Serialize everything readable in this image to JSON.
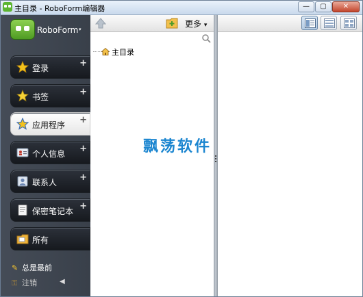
{
  "window": {
    "title": "主目录 - RoboForm编辑器",
    "minimize_glyph": "—",
    "maximize_glyph": "▢",
    "close_glyph": "✕"
  },
  "sidebar": {
    "brand": "RoboForm",
    "brand_caret": "▾",
    "items": [
      {
        "label": "登录",
        "icon": "login-star-icon",
        "plus": "+",
        "active": false
      },
      {
        "label": "书签",
        "icon": "bookmark-star-icon",
        "plus": "+",
        "active": false
      },
      {
        "label": "应用程序",
        "icon": "application-star-icon",
        "plus": "+",
        "active": true
      },
      {
        "label": "个人信息",
        "icon": "identity-card-icon",
        "plus": "+",
        "active": false
      },
      {
        "label": "联系人",
        "icon": "contacts-icon",
        "plus": "+",
        "active": false
      },
      {
        "label": "保密笔记本",
        "icon": "safenote-icon",
        "plus": "+",
        "active": false
      },
      {
        "label": "所有",
        "icon": "all-items-icon",
        "plus": "",
        "active": false
      }
    ],
    "pinned_label": "总是最前",
    "logout_label": "注销",
    "collapse_glyph": "◀"
  },
  "middle": {
    "more_label": "更多",
    "more_caret": "▾",
    "tree_root": "主目录",
    "watermark": "飘荡软件"
  },
  "right": {
    "views": [
      "detail-view-icon",
      "list-view-icon",
      "grid-view-icon"
    ]
  },
  "colors": {
    "sidebar_bg": "#3e444e",
    "active_item_bg": "#f2f2f2",
    "watermark": "#1c86d0",
    "brand_green": "#5cb531"
  }
}
